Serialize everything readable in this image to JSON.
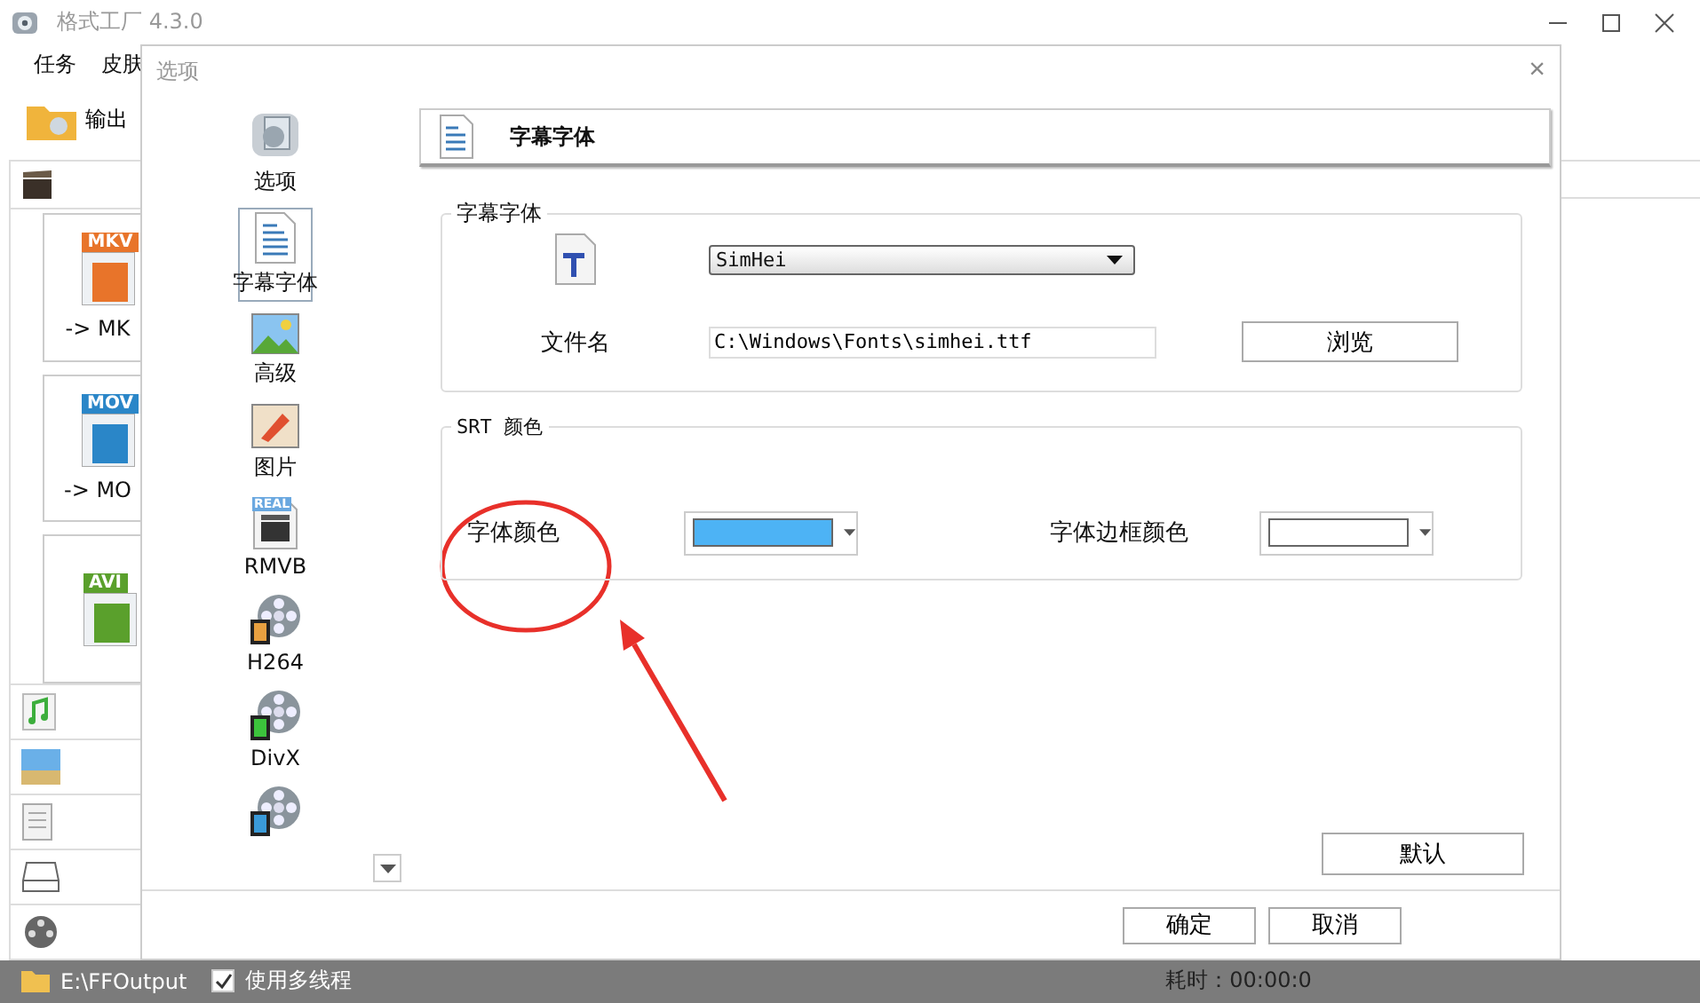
{
  "window": {
    "title": "格式工厂 4.3.0"
  },
  "menu": [
    "任务",
    "皮肤"
  ],
  "toolbar": {
    "label": "输出"
  },
  "tiles": [
    {
      "badge": "MKV",
      "label": "-> MK",
      "color": "#e8742a"
    },
    {
      "badge": "MOV",
      "label": "-> MO",
      "color": "#2a86c8"
    },
    {
      "badge": "AVI",
      "color": "#5aa02c"
    }
  ],
  "dialog": {
    "title": "选项",
    "close": "×",
    "nav": [
      {
        "kind": "options",
        "label": "选项",
        "selected": false
      },
      {
        "kind": "subtitle",
        "label": "字幕字体",
        "selected": true
      },
      {
        "kind": "advanced",
        "label": "高级",
        "selected": false
      },
      {
        "kind": "image",
        "label": "图片",
        "selected": false
      },
      {
        "kind": "rmvb",
        "label": "RMVB",
        "badge": "REAL",
        "selected": false
      },
      {
        "kind": "reel",
        "label": "H264",
        "color": "#e8a040",
        "selected": false
      },
      {
        "kind": "reel",
        "label": "DivX",
        "color": "#3cc43c",
        "selected": false
      },
      {
        "kind": "reel",
        "color": "#3a9ad8",
        "selected": false
      }
    ],
    "header": "字幕字体",
    "font_group": {
      "title": "字幕字体",
      "font": "SimHei",
      "file_label": "文件名",
      "file": "C:\\Windows\\Fonts\\simhei.ttf",
      "browse": "浏览"
    },
    "color_group": {
      "title": "SRT 颜色",
      "pickers": [
        {
          "label": "字体颜色",
          "color": "#4db3f5"
        },
        {
          "label": "字体边框颜色",
          "color": "#ffffff"
        }
      ]
    },
    "default_button": "默认",
    "ok": "确定",
    "cancel": "取消"
  },
  "status_bar": {
    "path": "E:\\FFOutput",
    "multithread": {
      "label": "使用多线程",
      "checked": true
    },
    "elapsed": "耗时：00:00:0"
  }
}
